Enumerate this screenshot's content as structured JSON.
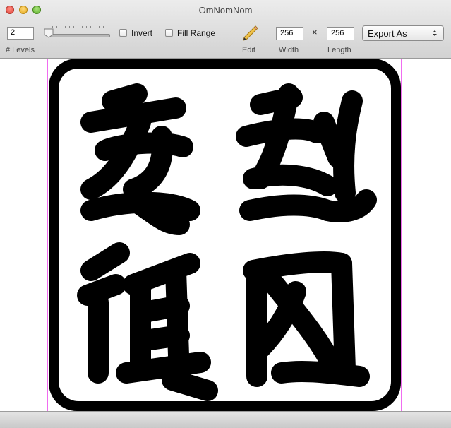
{
  "window": {
    "title": "OmNomNom"
  },
  "toolbar": {
    "levels_value": "2",
    "levels_label": "# Levels",
    "invert_label": "Invert",
    "fill_range_label": "Fill Range",
    "edit_label": "Edit",
    "width_value": "256",
    "width_label": "Width",
    "times_symbol": "×",
    "length_value": "256",
    "length_label": "Length",
    "export_label": "Export As"
  },
  "icons": {
    "close": "close-icon",
    "minimize": "minimize-icon",
    "zoom": "zoom-icon",
    "slider_thumb": "slider-thumb-icon",
    "edit": "pencil-icon",
    "popup": "chevron-updown-icon"
  },
  "colors": {
    "guide": "#f06cf0",
    "ink": "#000000",
    "paper": "#ffffff"
  }
}
